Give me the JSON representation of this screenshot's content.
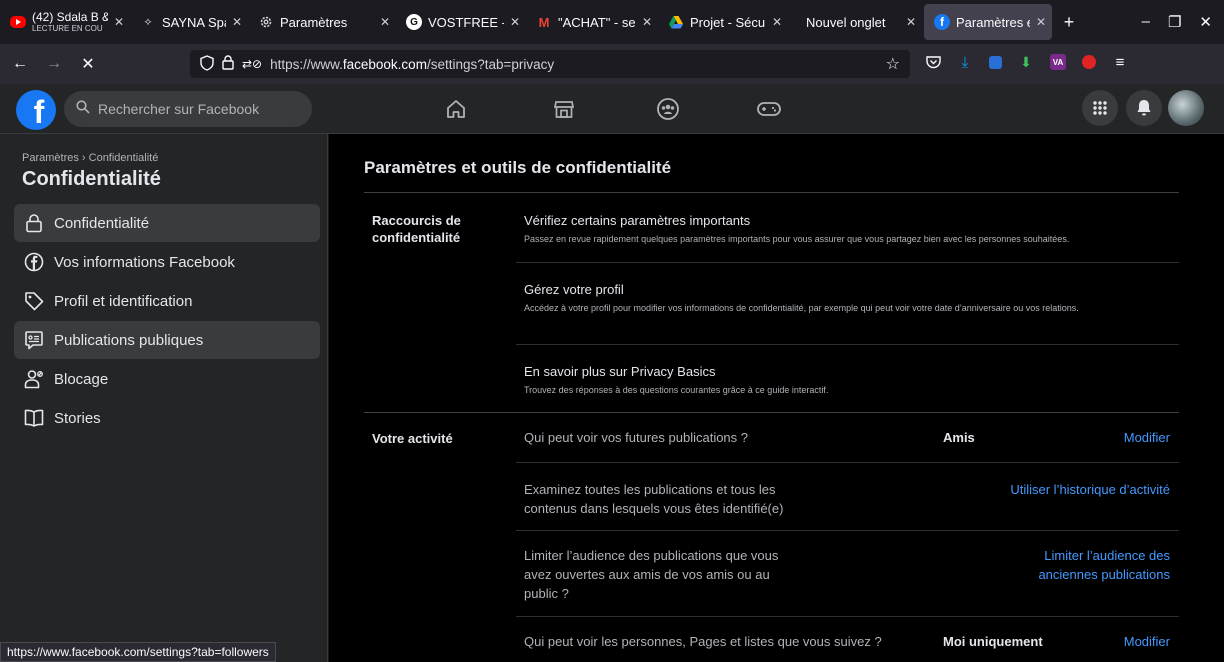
{
  "browser": {
    "tabs": [
      {
        "sub": "LECTURE EN COU",
        "title": "(42) Sdala B &",
        "favicon": "youtube-icon",
        "color": "#ff0000"
      },
      {
        "title": "SAYNA Space",
        "favicon": "sayna-icon",
        "color": "#cfcfd8"
      },
      {
        "title": "Paramètres",
        "favicon": "gear-icon",
        "color": "#cfcfd8"
      },
      {
        "title": "VOSTFREE - [",
        "favicon": "vostfree-icon",
        "color": "#ffffff"
      },
      {
        "title": "\"ACHAT\" - se",
        "favicon": "gmail-icon",
        "color": "#ea4335"
      },
      {
        "title": "Projet - Sécur",
        "favicon": "drive-icon",
        "color": "#fbbc04"
      },
      {
        "title": "Nouvel onglet",
        "favicon": "",
        "color": ""
      },
      {
        "title": "Paramètres et",
        "favicon": "facebook-icon",
        "color": "#1877f2"
      }
    ],
    "url_prefix": "https://www.",
    "url_domain": "facebook.com",
    "url_path": "/settings?tab=privacy",
    "status_url": "https://www.facebook.com/settings?tab=followers"
  },
  "fb": {
    "search_placeholder": "Rechercher sur Facebook",
    "brand_color": "#1877f2"
  },
  "sidebar": {
    "breadcrumb": "Paramètres › Confidentialité",
    "title": "Confidentialité",
    "items": [
      {
        "label": "Confidentialité",
        "icon": "lock-icon",
        "selected": true
      },
      {
        "label": "Vos informations Facebook",
        "icon": "facebook-circle-icon",
        "selected": false
      },
      {
        "label": "Profil et identification",
        "icon": "tag-icon",
        "selected": false
      },
      {
        "label": "Publications publiques",
        "icon": "public-post-icon",
        "selected": true
      },
      {
        "label": "Blocage",
        "icon": "block-user-icon",
        "selected": false
      },
      {
        "label": "Stories",
        "icon": "book-icon",
        "selected": false
      }
    ]
  },
  "main": {
    "title": "Paramètres et outils de confidentialité",
    "shortcuts_label": "Raccourcis de confidentialité",
    "shortcuts": [
      {
        "title": "Vérifiez certains paramètres importants",
        "desc": "Passez en revue rapidement quelques paramètres importants pour vous assurer que vous partagez bien avec les personnes souhaitées."
      },
      {
        "title": "Gérez votre profil",
        "desc": "Accédez à votre profil pour modifier vos informations de confidentialité, par exemple qui peut voir votre date d’anniversaire ou vos relations."
      },
      {
        "title": "En savoir plus sur Privacy Basics",
        "desc": "Trouvez des réponses à des questions courantes grâce à ce guide interactif."
      }
    ],
    "activity_label": "Votre activité",
    "activity": [
      {
        "text": "Qui peut voir vos futures publications ?",
        "value": "Amis",
        "link": "Modifier"
      },
      {
        "text": "Examinez toutes les publications et tous les contenus dans lesquels vous êtes identifié(e)",
        "value": "",
        "link": "Utiliser l’historique d’activité"
      },
      {
        "text": "Limiter l’audience des publications que vous avez ouvertes aux amis de vos amis ou au public ?",
        "value": "",
        "link": "Limiter l’audience des anciennes publications"
      },
      {
        "text": "Qui peut voir les personnes, Pages et listes que vous suivez ?",
        "value": "Moi uniquement",
        "link": "Modifier"
      }
    ]
  }
}
